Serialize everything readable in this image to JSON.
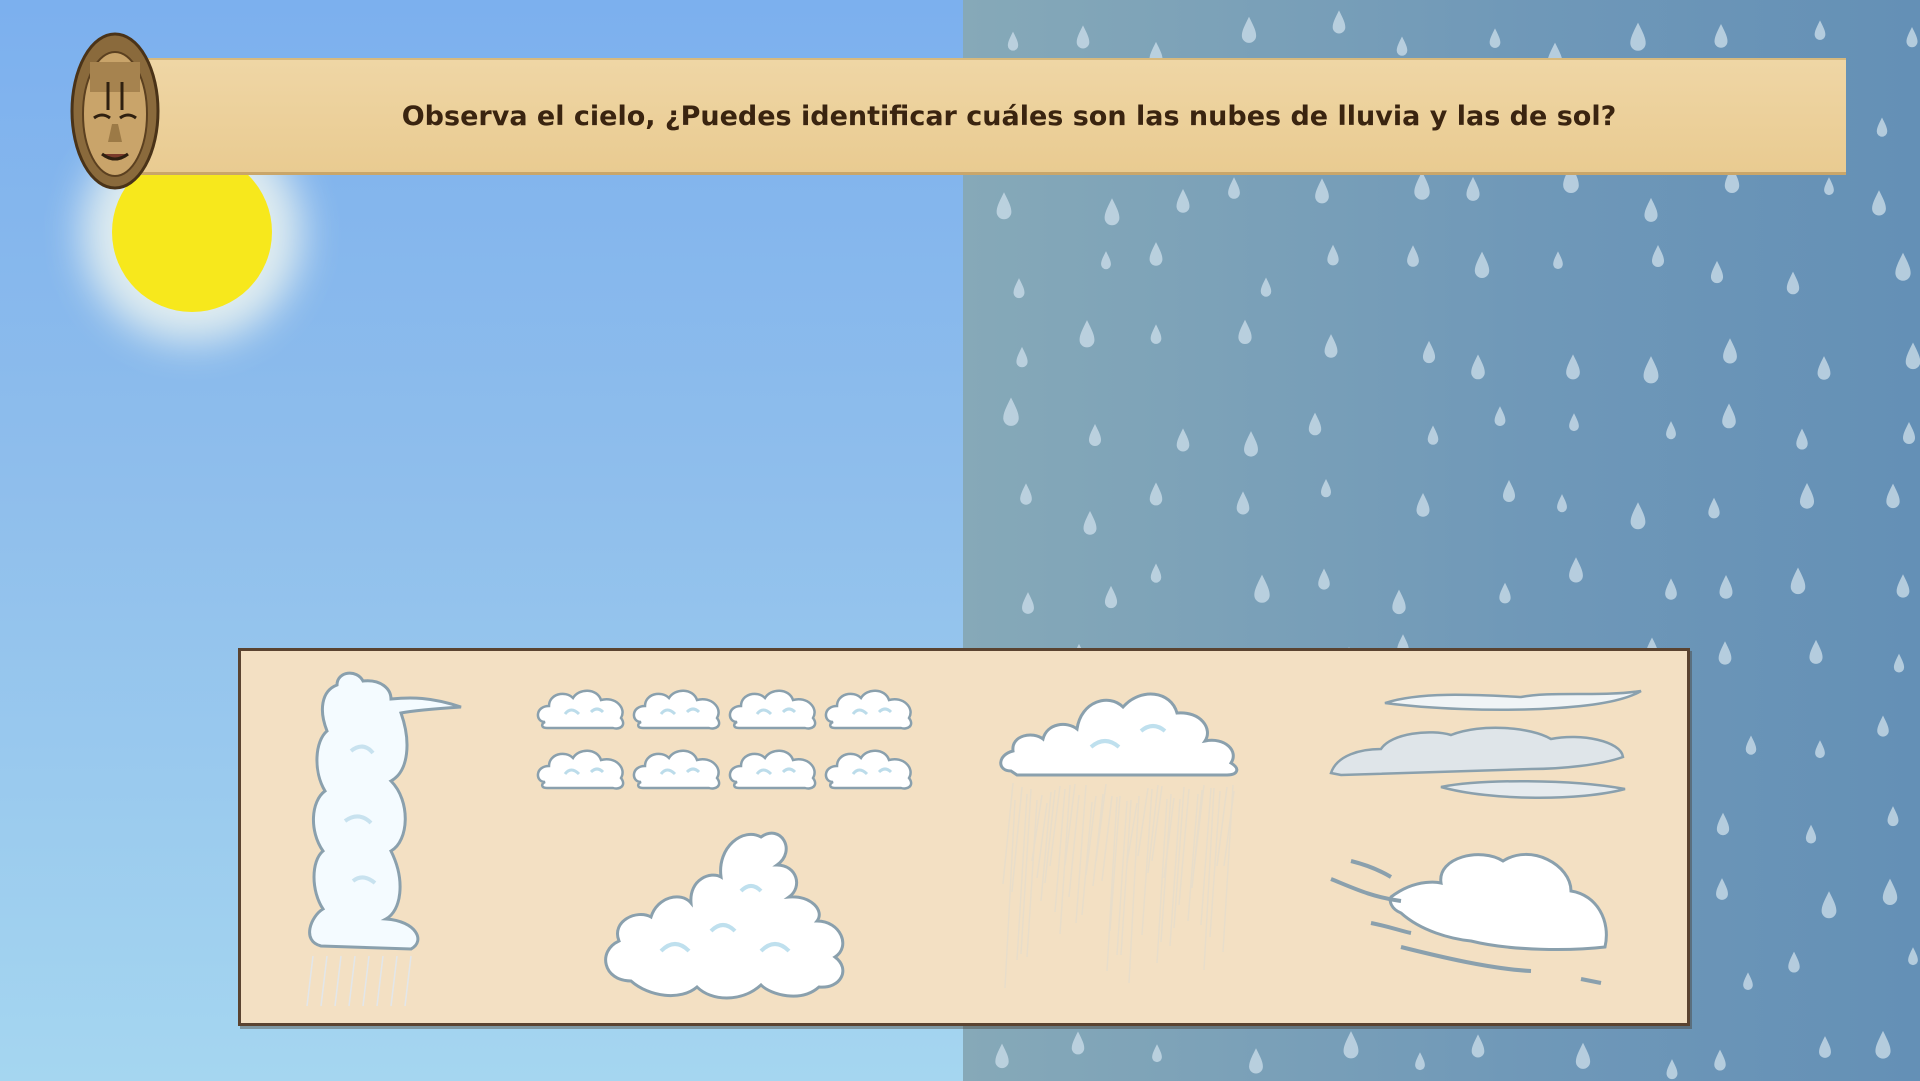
{
  "question": "Observa el cielo, ¿Puedes identificar cuáles son las nubes de lluvia y las de sol?",
  "colors": {
    "sun": "#f7e81c",
    "sky_sunny": "#8fbeec",
    "sky_rainy": "#6f98b8",
    "banner": "#e9cb91",
    "board": "#f3e0c3",
    "text": "#3a2410"
  },
  "icons": [
    "mask-icon",
    "sun-icon",
    "raindrop-icon",
    "cloud-icon"
  ],
  "clouds": [
    {
      "name": "cumulonimbus-cloud"
    },
    {
      "name": "cumulus-small-clouds"
    },
    {
      "name": "cumulus-puffy-cloud"
    },
    {
      "name": "nimbostratus-rain-cloud"
    },
    {
      "name": "stratus-clouds"
    },
    {
      "name": "windy-cloud"
    }
  ]
}
